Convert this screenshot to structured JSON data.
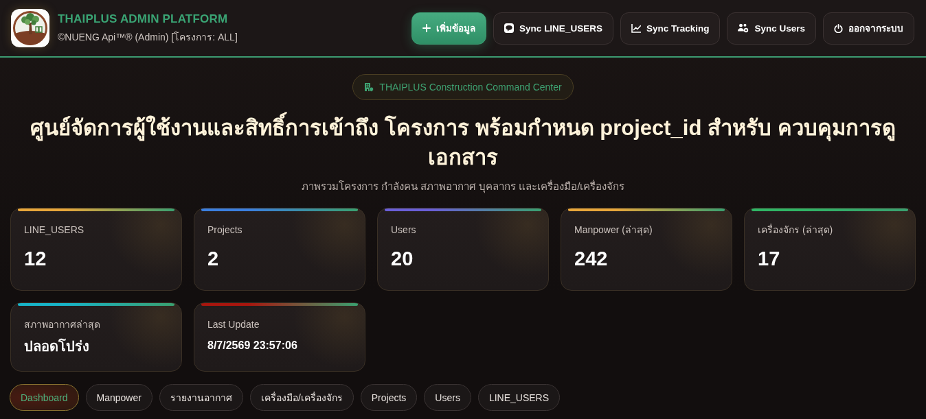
{
  "header": {
    "title": "THAIPLUS ADMIN PLATFORM",
    "subtitle": "©NUENG Api™® (Admin) [โครงการ: ALL]",
    "buttons": [
      {
        "label": "เพิ่มข้อมูล",
        "kind": "primary"
      },
      {
        "label": "Sync LINE_USERS",
        "kind": "outline"
      },
      {
        "label": "Sync Tracking",
        "kind": "outline"
      },
      {
        "label": "Sync Users",
        "kind": "outline"
      },
      {
        "label": "ออกจากระบบ",
        "kind": "outline"
      }
    ]
  },
  "hero": {
    "badge": "THAIPLUS Construction Command Center",
    "headline": "ศูนย์จัดการผู้ใช้งานและสิทธิ์การเข้าถึง โครงการ พร้อมกำหนด project_id สำหรับ ควบคุมการดูเอกสาร",
    "subtitle": "ภาพรวมโครงการ กำลังคน สภาพอากาศ บุคลากร และเครื่องมือ/เครื่องจักร"
  },
  "cards": [
    {
      "label": "LINE_USERS",
      "value": "12",
      "kind": "count",
      "color": "#e8a63a"
    },
    {
      "label": "Projects",
      "value": "2",
      "kind": "count",
      "color": "#3b7fe0"
    },
    {
      "label": "Users",
      "value": "20",
      "kind": "count",
      "color": "#6a5fd8"
    },
    {
      "label": "Manpower (ล่าสุด)",
      "value": "242",
      "kind": "count",
      "color": "#e8a63a"
    },
    {
      "label": "เครื่องจักร (ล่าสุด)",
      "value": "17",
      "kind": "count",
      "color": "#2fb565"
    },
    {
      "label": "สภาพอากาศล่าสุด",
      "value": "ปลอดโปร่ง",
      "kind": "status",
      "color": "#18b4c8"
    },
    {
      "label": "Last Update",
      "value": "8/7/2569 23:57:06",
      "kind": "timestamp",
      "color": "#a8160e"
    }
  ],
  "tabs": [
    {
      "label": "Dashboard",
      "selected": true
    },
    {
      "label": "Manpower",
      "selected": false
    },
    {
      "label": "รายงานอากาศ",
      "selected": false
    },
    {
      "label": "เครื่องมือ/เครื่องจักร",
      "selected": false
    },
    {
      "label": "Projects",
      "selected": false
    },
    {
      "label": "Users",
      "selected": false
    },
    {
      "label": "LINE_USERS",
      "selected": false
    }
  ]
}
